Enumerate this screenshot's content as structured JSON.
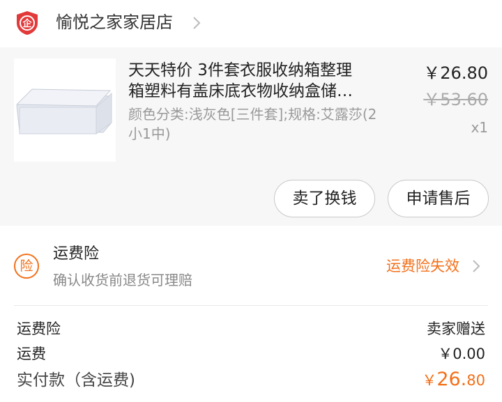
{
  "shop": {
    "logo_text": "企",
    "name": "愉悦之家家居店",
    "logo_color": "#e23a3a"
  },
  "product": {
    "title_line1": "天天特价 3件套衣服收纳箱整理",
    "title_line2": "箱塑料有盖床底衣物收纳盒储…",
    "sku": "颜色分类:浅灰色[三件套];规格:艾露莎(2小1中)",
    "price": "￥26.80",
    "original_price": "￥53.60",
    "quantity": "x1",
    "image_icon": "storage-box-image",
    "buttons": {
      "sell": "卖了换钱",
      "after_sale": "申请售后"
    }
  },
  "insurance": {
    "icon_text": "险",
    "title": "运费险",
    "description": "确认收货前退货可理赔",
    "status": "运费险失效",
    "accent_color": "#f2701a"
  },
  "summary": {
    "rows": [
      {
        "label": "运费险",
        "value": "卖家赠送"
      },
      {
        "label": "运费",
        "value": "￥0.00"
      }
    ],
    "total_label": "实付款（含运费)",
    "total_currency": "￥",
    "total_int": "26.",
    "total_dec": "80"
  }
}
